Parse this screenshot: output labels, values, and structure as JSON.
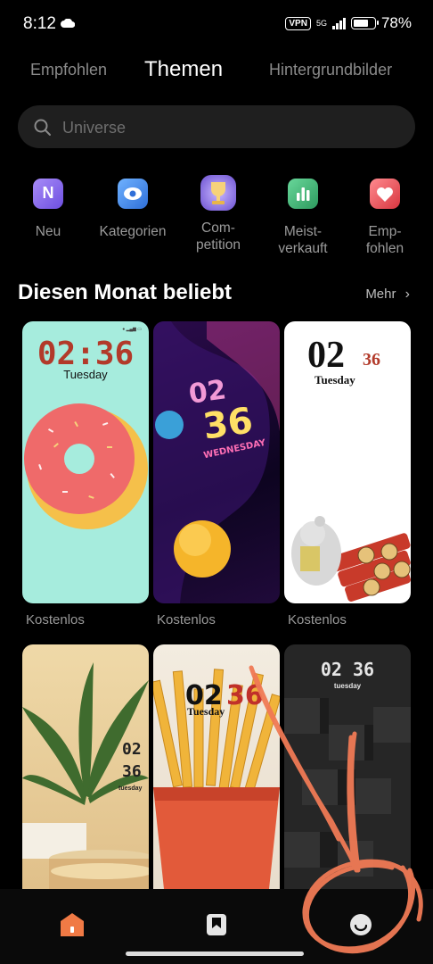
{
  "status": {
    "time": "8:12",
    "vpn": "VPN",
    "network": "5G",
    "battery": "78%",
    "battery_level": 0.78
  },
  "tabs": [
    {
      "label": "Empfohlen"
    },
    {
      "label": "Themen"
    },
    {
      "label": "Hintergrundbilder"
    }
  ],
  "search": {
    "placeholder": "Universe"
  },
  "categories": [
    {
      "label": "Neu",
      "icon": "new-icon",
      "color": "#8c6ff0"
    },
    {
      "label": "Kategorien",
      "icon": "eye-icon",
      "color": "#4a8fe8"
    },
    {
      "label": "Com-\npetition",
      "icon": "trophy-icon",
      "color": "#9a7fe0"
    },
    {
      "label": "Meist-\nverkauft",
      "icon": "chart-icon",
      "color": "#3fb37a"
    },
    {
      "label": "Emp-\nfohlen",
      "icon": "heart-icon",
      "color": "#e9535c"
    }
  ],
  "section": {
    "title": "Diesen Monat beliebt",
    "more": "Mehr"
  },
  "themes": [
    {
      "price": "Kostenlos",
      "clock": "02:36",
      "day": "Tuesday"
    },
    {
      "price": "Kostenlos",
      "clock_h": "02",
      "clock_m": "36",
      "day": "WEDNESDAY"
    },
    {
      "price": "Kostenlos",
      "clock_h": "02",
      "clock_m": "36",
      "day": "Tuesday"
    },
    {
      "clock_h": "02",
      "clock_m": "36",
      "day": "tuesday"
    },
    {
      "clock_h": "02",
      "clock_m": "36",
      "day": "Tuesday"
    },
    {
      "clock": "02 36",
      "day": "tuesday"
    }
  ],
  "bottom_nav": [
    {
      "icon": "home-icon"
    },
    {
      "icon": "bookmark-icon"
    },
    {
      "icon": "profile-icon"
    }
  ],
  "colors": {
    "accent": "#f07a45",
    "annotation": "#f07a55"
  }
}
